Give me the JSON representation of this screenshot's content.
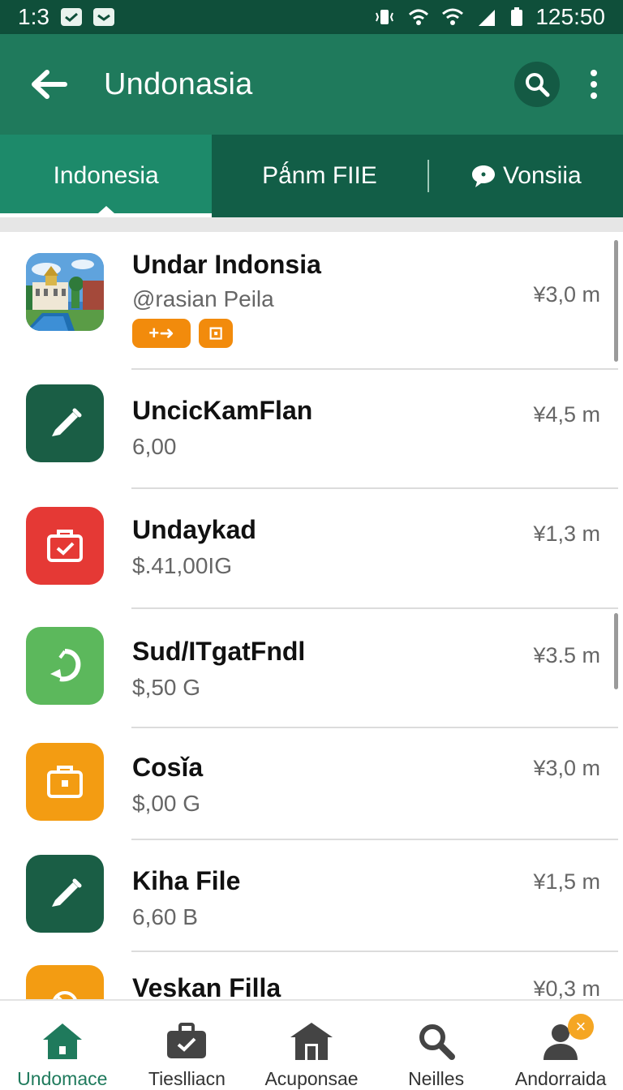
{
  "status_bar": {
    "time_left": "1:3",
    "time_right": "125:50"
  },
  "app_bar": {
    "title": "Undonasia",
    "icons": [
      "back-arrow-icon",
      "search-icon",
      "more-vert-icon"
    ]
  },
  "tabs": [
    {
      "label": "Indonesia",
      "active": true
    },
    {
      "label": "Pǻnm FIIE",
      "active": false
    },
    {
      "label": "Vonsiia",
      "active": false,
      "icon": "chat-bubble-icon"
    }
  ],
  "list": {
    "items": [
      {
        "title": "Undar Indonsia",
        "subtitle": "@rasian Peila",
        "size": "¥3,0 m",
        "icon": "building-photo",
        "icon_color": "#3b7fc4",
        "badges": [
          "+➜",
          "⊡"
        ]
      },
      {
        "title": "UncicKamFlan",
        "subtitle": "6,00",
        "size": "¥4,5 m",
        "icon": "pen-icon",
        "icon_color": "#1a5e45"
      },
      {
        "title": "Undaуkad",
        "subtitle": "$.41,00IG",
        "size": "¥1,3 m",
        "icon": "briefcase-check-icon",
        "icon_color": "#e53935"
      },
      {
        "title": "Sud/ITgatFnd​l",
        "subtitle": "$,50 G",
        "size": "¥3.5 m",
        "icon": "refresh-leaf-icon",
        "icon_color": "#5cb85c"
      },
      {
        "title": "Cosǐa",
        "subtitle": "$,00 G",
        "size": "¥3,0 m",
        "icon": "briefcase-icon",
        "icon_color": "#f39c12"
      },
      {
        "title": "Kiha File",
        "subtitle": "6,60 B",
        "size": "¥1,5 m",
        "icon": "pen-icon",
        "icon_color": "#1a5e45"
      },
      {
        "title": "Veskan Filla",
        "subtitle": "",
        "size": "¥0,3 m",
        "icon": "blocked-icon",
        "icon_color": "#f39c12"
      }
    ]
  },
  "bottom_nav": [
    {
      "label": "Undomace",
      "icon": "home-icon",
      "active": true
    },
    {
      "label": "Tieslliacn",
      "icon": "briefcase-check-icon",
      "active": false
    },
    {
      "label": "Acuponsae",
      "icon": "store-icon",
      "active": false
    },
    {
      "label": "Neilles",
      "icon": "search-icon",
      "active": false
    },
    {
      "label": "Andorraida",
      "icon": "person-icon",
      "active": false,
      "badge": "×"
    }
  ],
  "colors": {
    "status_bar": "#0f4f3a",
    "app_bar": "#1f7a5c",
    "tab_bar": "#125e47",
    "active_tab": "#1d8a6a",
    "badge_orange": "#f28b0c"
  }
}
